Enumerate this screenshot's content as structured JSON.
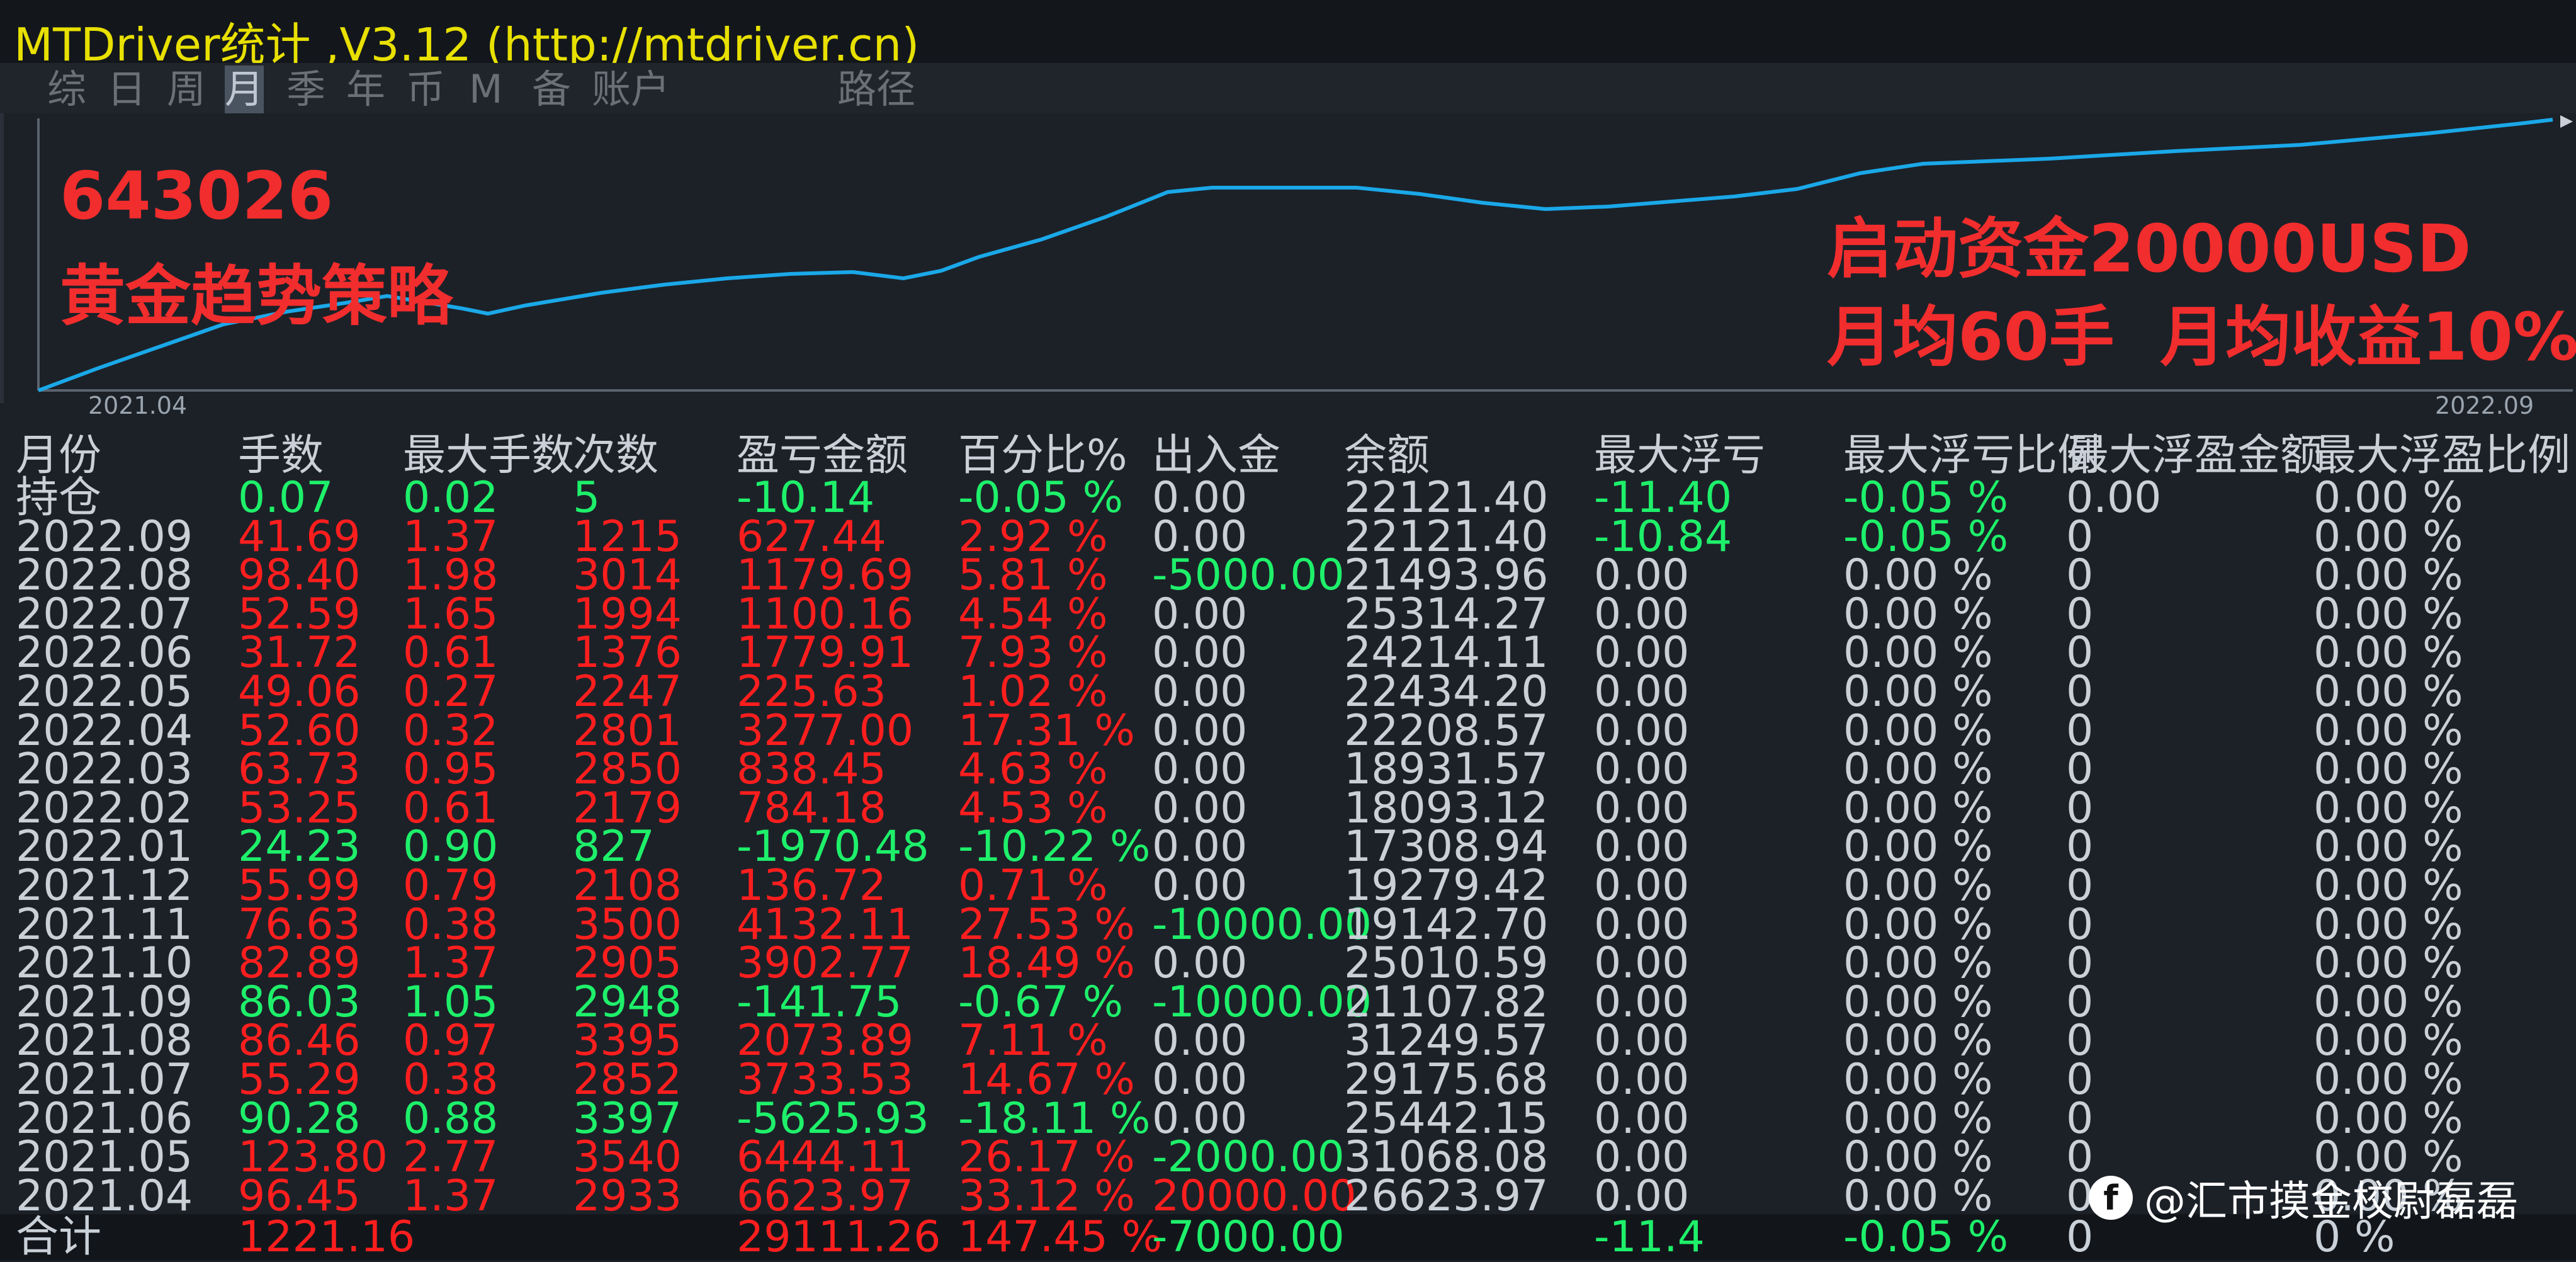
{
  "window": {
    "title": "MTDriver统计 ,V3.12 (http://mtdriver.cn)"
  },
  "menu": {
    "items": [
      {
        "label": "综",
        "active": false
      },
      {
        "label": "日",
        "active": false
      },
      {
        "label": "周",
        "active": false
      },
      {
        "label": "月",
        "active": true
      },
      {
        "label": "季",
        "active": false
      },
      {
        "label": "年",
        "active": false
      },
      {
        "label": "币",
        "active": false
      },
      {
        "label": "M",
        "active": false
      },
      {
        "label": "备",
        "active": false
      },
      {
        "label": "账户",
        "active": false
      },
      {
        "label": "路径",
        "active": false
      }
    ]
  },
  "chart_data": {
    "type": "line",
    "x_start_label": "2021.04",
    "x_end_label": "2022.09",
    "line_color": "#1aa8e8",
    "overlay": {
      "account": "643026",
      "strategy": "黄金趋势策略",
      "capital": "启动资金20000USD",
      "stats": "月均60手  月均收益10%"
    }
  },
  "table": {
    "columns": [
      "月份",
      "手数",
      "最大手数",
      "次数",
      "盈亏金额",
      "百分比%",
      "出入金",
      "余额",
      "最大浮亏",
      "最大浮亏比例",
      "最大浮盈金额",
      "最大浮盈比例"
    ],
    "rows": [
      {
        "c": [
          "持仓",
          "0.07",
          "0.02",
          "5",
          "-10.14",
          "-0.05 %",
          "0.00",
          "22121.40",
          "-11.40",
          "-0.05 %",
          "0.00",
          "0.00 %"
        ],
        "tone": "green"
      },
      {
        "c": [
          "2022.09",
          "41.69",
          "1.37",
          "1215",
          "627.44",
          "2.92 %",
          "0.00",
          "22121.40",
          "-10.84",
          "-0.05 %",
          "0",
          "0.00 %"
        ],
        "tone": "red"
      },
      {
        "c": [
          "2022.08",
          "98.40",
          "1.98",
          "3014",
          "1179.69",
          "5.81 %",
          "-5000.00",
          "21493.96",
          "0.00",
          "0.00 %",
          "0",
          "0.00 %"
        ],
        "tone": "red"
      },
      {
        "c": [
          "2022.07",
          "52.59",
          "1.65",
          "1994",
          "1100.16",
          "4.54 %",
          "0.00",
          "25314.27",
          "0.00",
          "0.00 %",
          "0",
          "0.00 %"
        ],
        "tone": "red"
      },
      {
        "c": [
          "2022.06",
          "31.72",
          "0.61",
          "1376",
          "1779.91",
          "7.93 %",
          "0.00",
          "24214.11",
          "0.00",
          "0.00 %",
          "0",
          "0.00 %"
        ],
        "tone": "red"
      },
      {
        "c": [
          "2022.05",
          "49.06",
          "0.27",
          "2247",
          "225.63",
          "1.02 %",
          "0.00",
          "22434.20",
          "0.00",
          "0.00 %",
          "0",
          "0.00 %"
        ],
        "tone": "red"
      },
      {
        "c": [
          "2022.04",
          "52.60",
          "0.32",
          "2801",
          "3277.00",
          "17.31 %",
          "0.00",
          "22208.57",
          "0.00",
          "0.00 %",
          "0",
          "0.00 %"
        ],
        "tone": "red"
      },
      {
        "c": [
          "2022.03",
          "63.73",
          "0.95",
          "2850",
          "838.45",
          "4.63 %",
          "0.00",
          "18931.57",
          "0.00",
          "0.00 %",
          "0",
          "0.00 %"
        ],
        "tone": "red"
      },
      {
        "c": [
          "2022.02",
          "53.25",
          "0.61",
          "2179",
          "784.18",
          "4.53 %",
          "0.00",
          "18093.12",
          "0.00",
          "0.00 %",
          "0",
          "0.00 %"
        ],
        "tone": "red"
      },
      {
        "c": [
          "2022.01",
          "24.23",
          "0.90",
          "827",
          "-1970.48",
          "-10.22 %",
          "0.00",
          "17308.94",
          "0.00",
          "0.00 %",
          "0",
          "0.00 %"
        ],
        "tone": "green"
      },
      {
        "c": [
          "2021.12",
          "55.99",
          "0.79",
          "2108",
          "136.72",
          "0.71 %",
          "0.00",
          "19279.42",
          "0.00",
          "0.00 %",
          "0",
          "0.00 %"
        ],
        "tone": "red"
      },
      {
        "c": [
          "2021.11",
          "76.63",
          "0.38",
          "3500",
          "4132.11",
          "27.53 %",
          "-10000.00",
          "19142.70",
          "0.00",
          "0.00 %",
          "0",
          "0.00 %"
        ],
        "tone": "red"
      },
      {
        "c": [
          "2021.10",
          "82.89",
          "1.37",
          "2905",
          "3902.77",
          "18.49 %",
          "0.00",
          "25010.59",
          "0.00",
          "0.00 %",
          "0",
          "0.00 %"
        ],
        "tone": "red"
      },
      {
        "c": [
          "2021.09",
          "86.03",
          "1.05",
          "2948",
          "-141.75",
          "-0.67 %",
          "-10000.00",
          "21107.82",
          "0.00",
          "0.00 %",
          "0",
          "0.00 %"
        ],
        "tone": "green"
      },
      {
        "c": [
          "2021.08",
          "86.46",
          "0.97",
          "3395",
          "2073.89",
          "7.11 %",
          "0.00",
          "31249.57",
          "0.00",
          "0.00 %",
          "0",
          "0.00 %"
        ],
        "tone": "red"
      },
      {
        "c": [
          "2021.07",
          "55.29",
          "0.38",
          "2852",
          "3733.53",
          "14.67 %",
          "0.00",
          "29175.68",
          "0.00",
          "0.00 %",
          "0",
          "0.00 %"
        ],
        "tone": "red"
      },
      {
        "c": [
          "2021.06",
          "90.28",
          "0.88",
          "3397",
          "-5625.93",
          "-18.11 %",
          "0.00",
          "25442.15",
          "0.00",
          "0.00 %",
          "0",
          "0.00 %"
        ],
        "tone": "green"
      },
      {
        "c": [
          "2021.05",
          "123.80",
          "2.77",
          "3540",
          "6444.11",
          "26.17 %",
          "-2000.00",
          "31068.08",
          "0.00",
          "0.00 %",
          "0",
          "0.00 %"
        ],
        "tone": "red"
      },
      {
        "c": [
          "2021.04",
          "96.45",
          "1.37",
          "2933",
          "6623.97",
          "33.12 %",
          "20000.00",
          "26623.97",
          "0.00",
          "0.00 %",
          "0",
          "0.00 %"
        ],
        "tone": "red"
      }
    ],
    "total": [
      "合计",
      "1221.16",
      "",
      "",
      "29111.26",
      "147.45 %",
      "-7000.00",
      "",
      "-11.4",
      "-0.05 %",
      "0",
      "0 %"
    ]
  },
  "watermark": {
    "text": "@汇市摸金校尉磊磊",
    "logo": "f-logo-icon"
  },
  "colors": {
    "title": "#e8e000",
    "profit": "#ff1e1e",
    "loss": "#1ef06a",
    "neutral": "#c9d0d8",
    "curve": "#1aa8e8",
    "annotation": "#f22d2d"
  }
}
